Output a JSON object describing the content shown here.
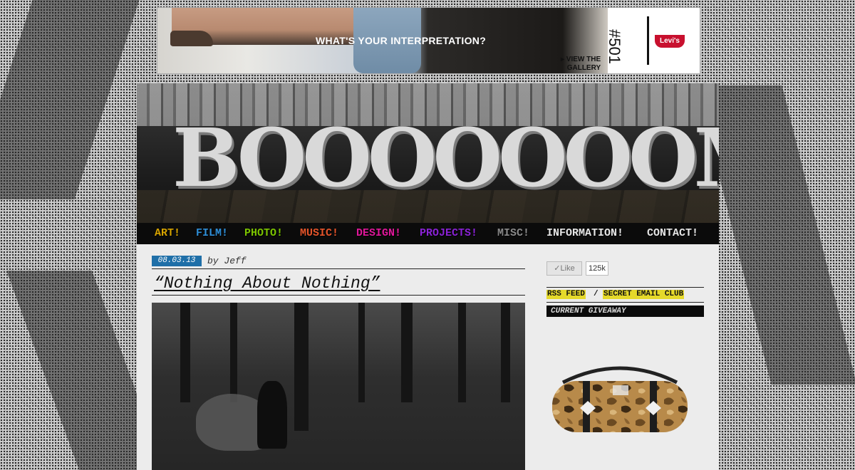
{
  "ad": {
    "headline": "WHAT'S YOUR INTERPRETATION?",
    "cta_line1": "▸ VIEW THE",
    "cta_line2": "GALLERY",
    "product": "#501",
    "brand": "Levi's"
  },
  "header": {
    "logo_text": "BOOOOOOOM"
  },
  "nav": {
    "items": [
      {
        "label": "ART!",
        "color": "#d6a300"
      },
      {
        "label": "FILM!",
        "color": "#2f8fd8"
      },
      {
        "label": "PHOTO!",
        "color": "#7cc400"
      },
      {
        "label": "MUSIC!",
        "color": "#e4542a"
      },
      {
        "label": "DESIGN!",
        "color": "#e0179a"
      },
      {
        "label": "PROJECTS!",
        "color": "#8a22d6"
      },
      {
        "label": "MISC!",
        "color": "#8a8a8a"
      },
      {
        "label": "INFORMATION!",
        "color": "#e6e6e6"
      },
      {
        "label": "CONTACT!",
        "color": "#e6e6e6"
      }
    ]
  },
  "post": {
    "date": "08.03.13",
    "author": "by Jeff",
    "title": "“Nothing About Nothing”"
  },
  "sidebar": {
    "like_label": "✓Like",
    "like_count": "125k",
    "rss_label": "RSS FEED",
    "separator": "/",
    "email_label": "SECRET EMAIL CLUB",
    "giveaway_label": "CURRENT GIVEAWAY"
  }
}
